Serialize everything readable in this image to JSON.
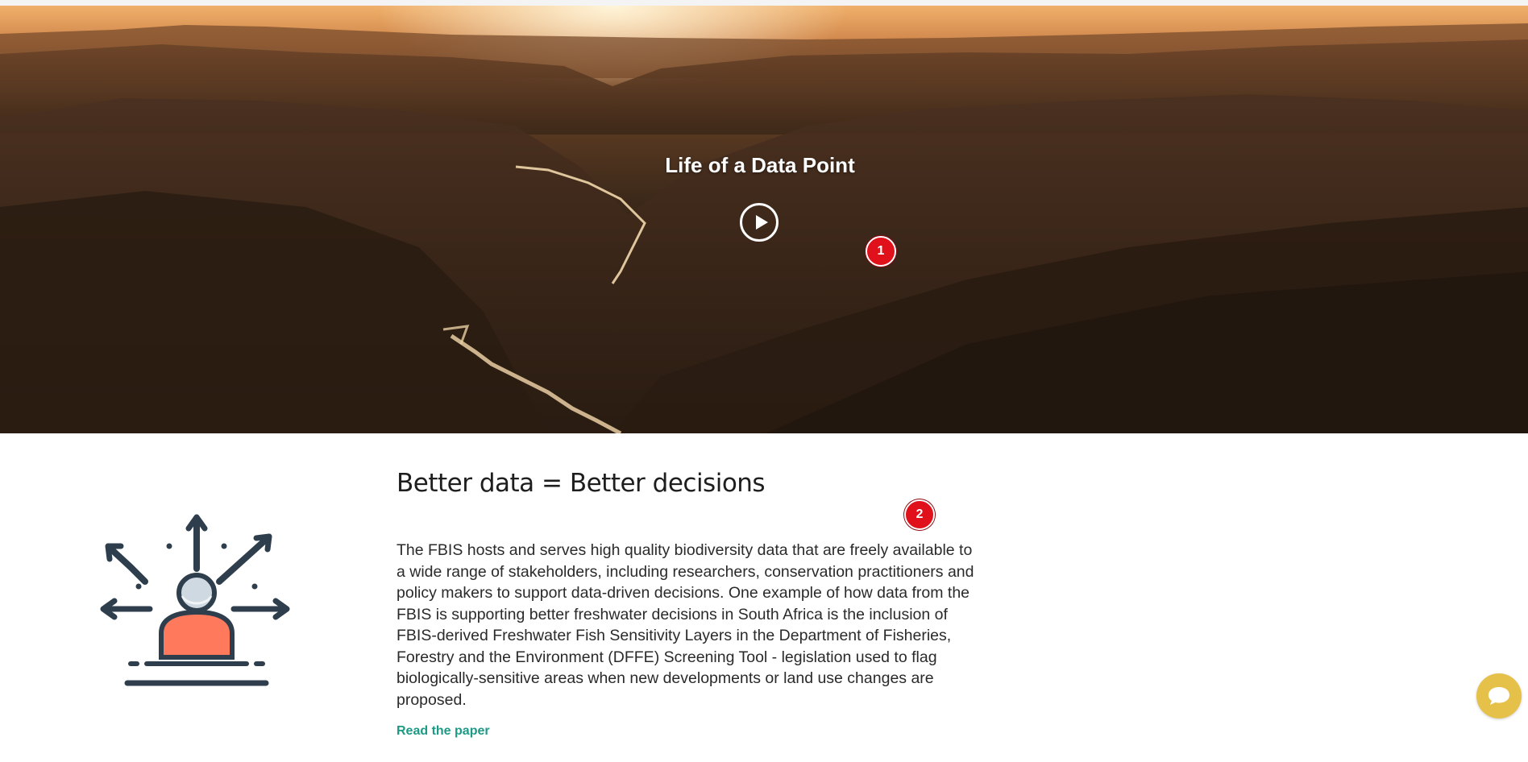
{
  "hero": {
    "title": "Life of a Data Point",
    "play_label": "Play video"
  },
  "markers": {
    "m1": "1",
    "m2": "2"
  },
  "section": {
    "title": "Better data = Better decisions",
    "body": "The FBIS hosts and serves high quality biodiversity data that are freely available to a wide range of stakeholders, including researchers, conservation practitioners and policy makers to support data-driven decisions. One example of how data from the FBIS is supporting better freshwater decisions in South Africa is the inclusion of FBIS-derived Freshwater Fish Sensitivity Layers in the Department of Fisheries, Forestry and the Environment (DFFE) Screening Tool - legislation used to flag biologically-sensitive areas when new developments or land use changes are proposed.",
    "link_label": "Read the paper"
  },
  "icons": {
    "illustration": "person-decision-arrows-icon",
    "play": "play-icon",
    "chat": "chat-bubble-icon"
  },
  "colors": {
    "link": "#1d9a85",
    "marker": "#e0111b",
    "chat": "#e5c14a",
    "illustration_accent": "#ff7a5c",
    "illustration_dark": "#2f3e4c"
  }
}
